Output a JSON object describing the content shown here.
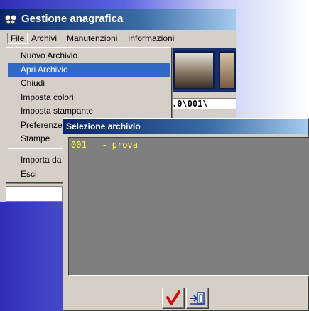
{
  "main_window": {
    "title": "Gestione anagrafica",
    "menu": [
      "File",
      "Archivi",
      "Manutenzioni",
      "Informazioni"
    ],
    "path_text": ".0\\001\\"
  },
  "file_menu": {
    "items": [
      "Nuovo Archivio",
      "Apri Archivio",
      "Chiudi",
      "Imposta colori",
      "Imposta stampante",
      "Preferenze",
      "Stampe",
      "Importa da",
      "Esci"
    ],
    "selected": "Apri Archivio"
  },
  "dialog": {
    "title": "Selezione archivio",
    "rows": [
      "001   - prova"
    ]
  },
  "colors": {
    "accent": "#316ac5",
    "list_text": "#ffff40",
    "list_bg": "#7f7f7f",
    "ok_check": "#cc1010"
  },
  "icons": {
    "app": "butterfly-icon",
    "ok": "checkmark-icon",
    "exit": "exit-door-icon"
  }
}
